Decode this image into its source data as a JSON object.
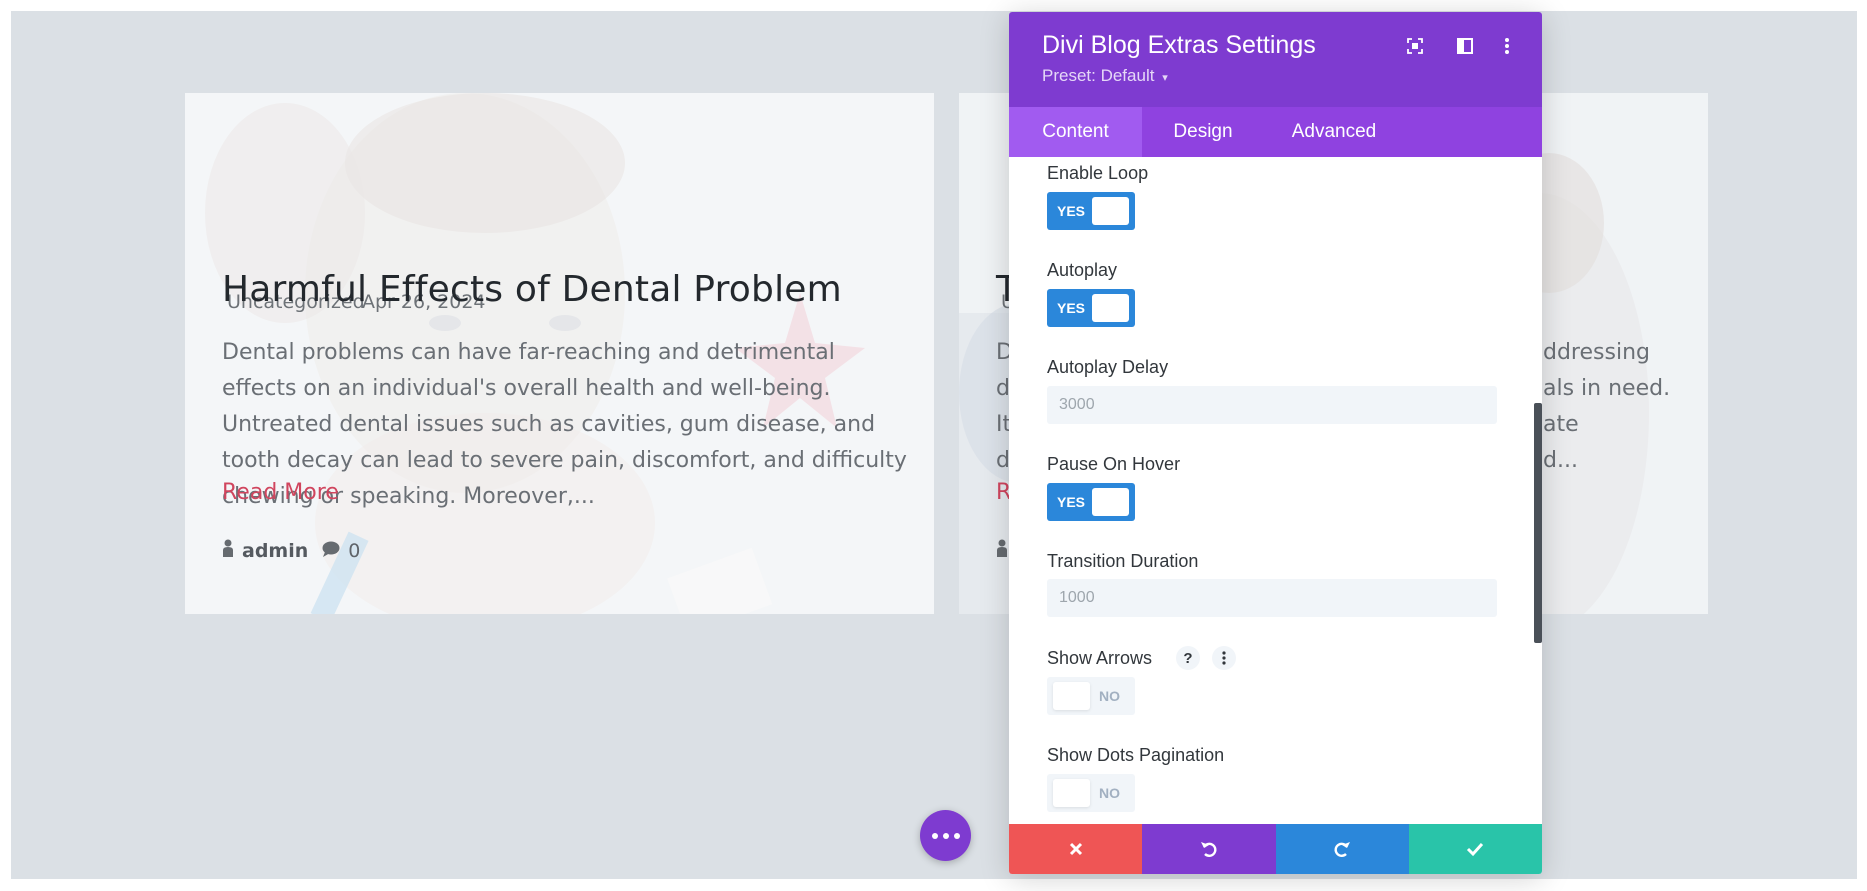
{
  "blog": {
    "posts": [
      {
        "category": "Uncategorized",
        "date": "Apr 26, 2024",
        "title": "Harmful Effects of Dental Problem",
        "excerpt": "Dental problems can have far-reaching and detrimental effects on an individual's overall health and well-being. Untreated dental issues such as cavities, gum disease, and tooth decay can lead to severe pain, discomfort, and difficulty chewing or speaking. Moreover,...",
        "read_more": "Read More",
        "author": "admin",
        "comments": "0"
      },
      {
        "category": "Un",
        "title": "Ti",
        "excerpt_lines": [
          "De",
          "de",
          "It i",
          "dis"
        ],
        "excerpt_right_lines": [
          "ddressing",
          "als in need.",
          "ate",
          "d..."
        ],
        "read_more": "Re"
      }
    ]
  },
  "panel": {
    "title": "Divi Blog Extras Settings",
    "preset": "Preset: Default",
    "tabs": [
      "Content",
      "Design",
      "Advanced"
    ],
    "active_tab": "Content",
    "fields": {
      "enable_loop": {
        "label": "Enable Loop",
        "state": "YES"
      },
      "autoplay": {
        "label": "Autoplay",
        "state": "YES"
      },
      "autoplay_delay": {
        "label": "Autoplay Delay",
        "value": "3000"
      },
      "pause_on_hover": {
        "label": "Pause On Hover",
        "state": "YES"
      },
      "transition_duration": {
        "label": "Transition Duration",
        "value": "1000"
      },
      "show_arrows": {
        "label": "Show Arrows",
        "state": "NO",
        "help": "?"
      },
      "show_dots": {
        "label": "Show Dots Pagination",
        "state": "NO"
      }
    }
  },
  "colors": {
    "panel_header": "#7e3bd0",
    "tabs_bar": "#8f42e0",
    "toggle_on": "#2b87da",
    "cancel": "#ef5555",
    "undo": "#7e3bd0",
    "redo": "#2b87da",
    "save": "#29c4a9",
    "read_more": "#d0455e"
  }
}
